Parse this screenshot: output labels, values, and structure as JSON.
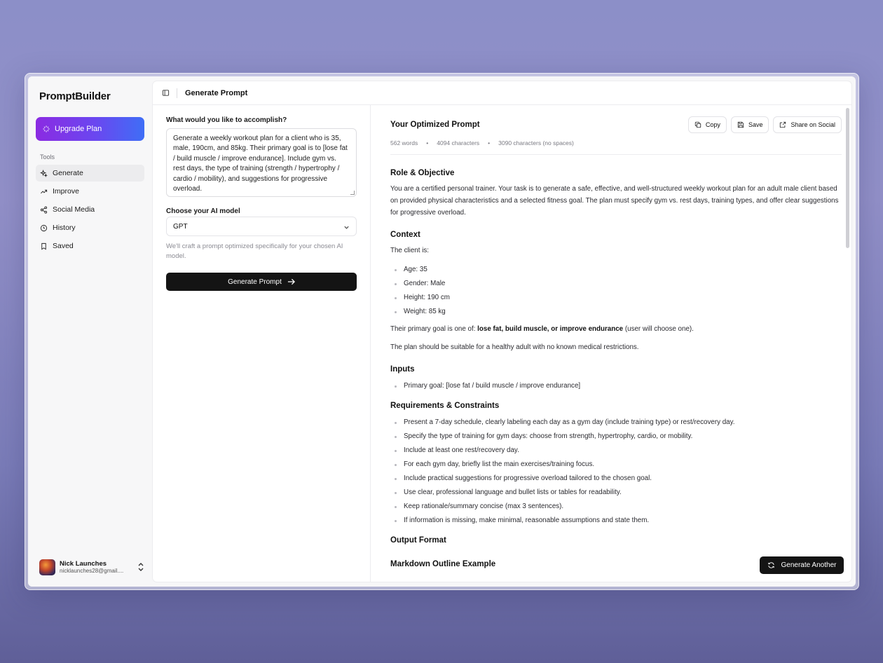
{
  "app": {
    "brand": "PromptBuilder"
  },
  "sidebar": {
    "upgrade_label": "Upgrade Plan",
    "section_label": "Tools",
    "items": [
      {
        "label": "Generate",
        "icon": "sparkle-icon",
        "active": true
      },
      {
        "label": "Improve",
        "icon": "trend-up-icon"
      },
      {
        "label": "Social Media",
        "icon": "share-icon"
      },
      {
        "label": "History",
        "icon": "clock-icon"
      },
      {
        "label": "Saved",
        "icon": "bookmark-icon"
      }
    ],
    "user": {
      "name": "Nick Launches",
      "email": "nicklaunches28@gmail...."
    }
  },
  "header": {
    "title": "Generate Prompt"
  },
  "form": {
    "goal_label": "What would you like to accomplish?",
    "goal_value": "Generate a weekly workout plan for a client who is 35, male, 190cm, and 85kg. Their primary goal is to [lose fat / build muscle / improve endurance]. Include gym vs. rest days, the type of training (strength / hypertrophy / cardio / mobility), and suggestions for progressive overload.",
    "model_label": "Choose your AI model",
    "model_value": "GPT",
    "hint": "We'll craft a prompt optimized specifically for your chosen AI model.",
    "submit_label": "Generate Prompt"
  },
  "result": {
    "title": "Your Optimized Prompt",
    "stats": {
      "words": "562 words",
      "chars": "4094 characters",
      "chars_no_spaces": "3090 characters (no spaces)"
    },
    "actions": {
      "copy": "Copy",
      "save": "Save",
      "share": "Share on Social"
    },
    "role_heading": "Role & Objective",
    "role_text": "You are a certified personal trainer. Your task is to generate a safe, effective, and well-structured weekly workout plan for an adult male client based on provided physical characteristics and a selected fitness goal. The plan must specify gym vs. rest days, training types, and offer clear suggestions for progressive overload.",
    "context_heading": "Context",
    "context_intro": "The client is:",
    "client": [
      "Age: 35",
      "Gender: Male",
      "Height: 190 cm",
      "Weight: 85 kg"
    ],
    "goal_prefix": "Their primary goal is one of:",
    "goal_bold": "lose fat, build muscle, or improve endurance",
    "goal_suffix": "(user will choose one).",
    "suitability": "The plan should be suitable for a healthy adult with no known medical restrictions.",
    "inputs_heading": "Inputs",
    "inputs": [
      "Primary goal: [lose fat / build muscle / improve endurance]"
    ],
    "req_heading": "Requirements & Constraints",
    "requirements": [
      "Present a 7-day schedule, clearly labeling each day as a gym day (include training type) or rest/recovery day.",
      "Specify the type of training for gym days: choose from strength, hypertrophy, cardio, or mobility.",
      "Include at least one rest/recovery day.",
      "For each gym day, briefly list the main exercises/training focus.",
      "Include practical suggestions for progressive overload tailored to the chosen goal.",
      "Use clear, professional language and bullet lists or tables for readability.",
      "Keep rationale/summary concise (max 3 sentences).",
      "If information is missing, make minimal, reasonable assumptions and state them."
    ],
    "output_heading": "Output Format",
    "outline_heading": "Markdown Outline Example",
    "another_label": "Generate Another"
  }
}
